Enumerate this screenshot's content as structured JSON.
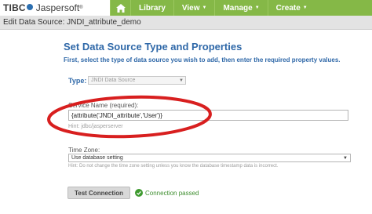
{
  "header": {
    "logo_prefix": "TIBC",
    "logo_suffix": "Jaspersoft",
    "logo_mark": "®",
    "nav": [
      {
        "label": "Library"
      },
      {
        "label": "View",
        "caret": "▼"
      },
      {
        "label": "Manage",
        "caret": "▼"
      },
      {
        "label": "Create",
        "caret": "▼"
      }
    ],
    "icons": {
      "home": "home-icon"
    }
  },
  "edit_bar": {
    "text": "Edit Data Source: JNDI_attribute_demo"
  },
  "main": {
    "title": "Set Data Source Type and Properties",
    "instructions": "First, select the type of data source you wish to add, then enter the required property values.",
    "type": {
      "label": "Type:",
      "selected": "JNDI Data Source"
    },
    "service_name": {
      "label": "Service Name (required):",
      "value": "{attribute('JNDI_attribute','User')}",
      "hint": "Hint: jdbc/jasperserver"
    },
    "time_zone": {
      "label": "Time Zone:",
      "selected": "Use database setting",
      "hint": "Hint: Do not change the time zone setting unless you know the database timestamp data is incorrect."
    },
    "test_connection": {
      "button_label": "Test Connection",
      "status_text": "Connection passed",
      "status_icon": "check-circle-icon"
    }
  },
  "colors": {
    "nav_green": "#85b847",
    "title_blue": "#2f68a8",
    "annotation_red": "#d81f1f",
    "success_green": "#3e8e2f"
  }
}
